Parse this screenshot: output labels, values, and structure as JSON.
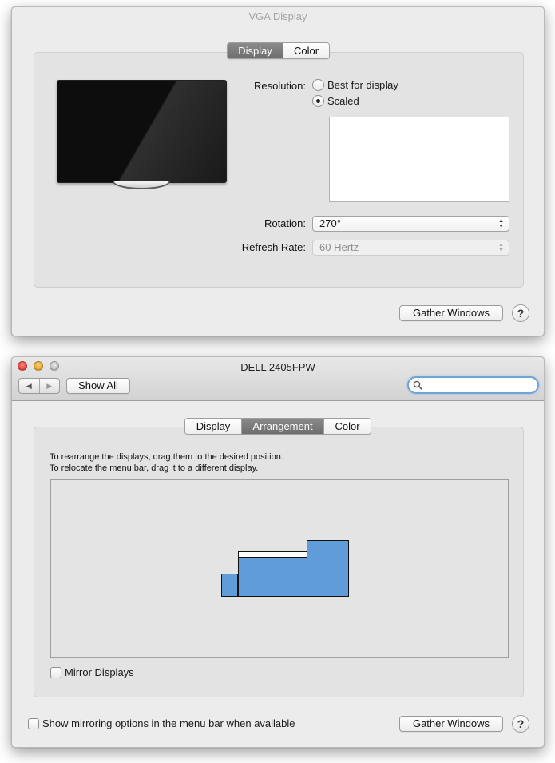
{
  "vga_window": {
    "title": "VGA Display",
    "tabs": [
      {
        "label": "Display",
        "active": true
      },
      {
        "label": "Color",
        "active": false
      }
    ],
    "resolution": {
      "label": "Resolution:",
      "options": [
        {
          "label": "Best for display",
          "selected": false
        },
        {
          "label": "Scaled",
          "selected": true
        }
      ]
    },
    "rotation": {
      "label": "Rotation:",
      "value": "270°"
    },
    "refresh_rate": {
      "label": "Refresh Rate:",
      "value": "60 Hertz",
      "enabled": false
    },
    "gather_windows": "Gather Windows",
    "help": "?"
  },
  "dell_window": {
    "title": "DELL 2405FPW",
    "toolbar": {
      "back": "◀",
      "forward": "▶",
      "show_all": "Show All",
      "search_placeholder": ""
    },
    "tabs": [
      {
        "label": "Display",
        "active": false
      },
      {
        "label": "Arrangement",
        "active": true
      },
      {
        "label": "Color",
        "active": false
      }
    ],
    "instructions": [
      "To rearrange the displays, drag them to the desired position.",
      "To relocate the menu bar, drag it to a different display."
    ],
    "mirror_displays": {
      "label": "Mirror Displays",
      "checked": false
    },
    "show_mirroring": {
      "label": "Show mirroring options in the menu bar when available",
      "checked": false
    },
    "gather_windows": "Gather Windows",
    "help": "?"
  },
  "colors": {
    "display_blue": "#609cd8",
    "active_tab": "#7b7b7b",
    "search_focus": "#6fa3dc"
  }
}
